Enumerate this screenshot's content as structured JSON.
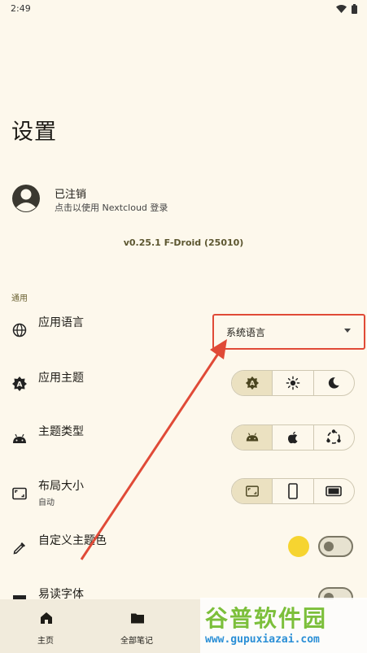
{
  "status": {
    "time": "2:49"
  },
  "page": {
    "title": "设置"
  },
  "account": {
    "name": "已注销",
    "subtitle": "点击以使用 Nextcloud 登录"
  },
  "version": "v0.25.1 F-Droid (25010)",
  "section": "通用",
  "settings": {
    "language": {
      "title": "应用语言",
      "value": "系统语言"
    },
    "theme": {
      "title": "应用主题",
      "options": [
        "auto-a-icon",
        "sun-icon",
        "moon-icon"
      ],
      "selected": 0
    },
    "theme_type": {
      "title": "主题类型",
      "options": [
        "android-icon",
        "apple-icon",
        "nextcloud-icon"
      ],
      "selected": 0
    },
    "layout_size": {
      "title": "布局大小",
      "subtitle": "自动",
      "options": [
        "auto-size-icon",
        "phone-icon",
        "tablet-icon"
      ],
      "selected": 0
    },
    "custom_color": {
      "title": "自定义主题色",
      "color": "#f6d430",
      "enabled": false
    },
    "readable_font": {
      "title": "易读字体",
      "enabled": false
    }
  },
  "bottom_nav": {
    "home": "主页",
    "all_notes": "全部笔记"
  },
  "watermark": {
    "main": "谷普软件园",
    "url": "www.gupuxiazai.com"
  },
  "colors": {
    "background": "#fdf8ec",
    "selected": "#ebe1c1",
    "annotation": "#e04a37",
    "accent": "#5c5630"
  }
}
